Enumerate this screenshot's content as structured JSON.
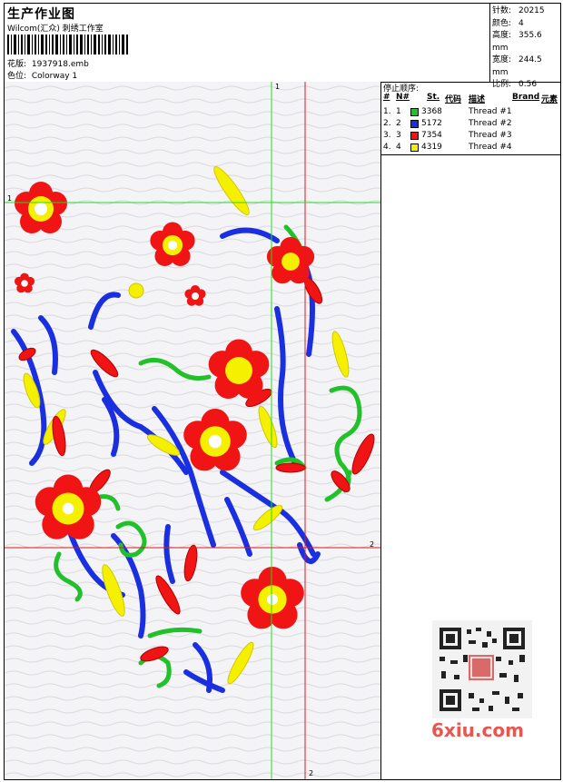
{
  "header": {
    "title": "生产作业图",
    "software": "Wilcom(汇众) 刺绣工作室",
    "pattern_label": "花版:",
    "pattern_value": "1937918.emb",
    "colorway_label": "色位:",
    "colorway_value": "Colorway 1"
  },
  "specs": [
    {
      "label": "针数:",
      "value": "20215"
    },
    {
      "label": "颜色:",
      "value": "4"
    },
    {
      "label": "高度:",
      "value": "355.6 mm"
    },
    {
      "label": "宽度:",
      "value": "244.5 mm"
    },
    {
      "label": "比例:",
      "value": "0.56"
    }
  ],
  "stop_sequence": {
    "title": "停止顺序:",
    "headers": {
      "num": "#",
      "n": "N#",
      "st": "St.",
      "code": "代码",
      "desc": "描述",
      "brand": "Brand",
      "element": "元素"
    },
    "rows": [
      {
        "num": "1.",
        "n": "1",
        "color": "#22c02a",
        "code": "3368",
        "desc": "Thread #1"
      },
      {
        "num": "2.",
        "n": "2",
        "color": "#1a2fe0",
        "code": "5172",
        "desc": "Thread #2"
      },
      {
        "num": "3.",
        "n": "3",
        "color": "#f01414",
        "code": "7354",
        "desc": "Thread #3"
      },
      {
        "num": "4.",
        "n": "4",
        "color": "#f5f000",
        "code": "4319",
        "desc": "Thread #4"
      }
    ]
  },
  "axis_labels": {
    "top": "1",
    "right": "2",
    "bottom": "2",
    "left": "1"
  },
  "watermark": "6xiu.com",
  "colors": {
    "green": "#22c02a",
    "blue": "#1a2fe0",
    "red": "#f01414",
    "yellow": "#f5f000",
    "guide_green": "#22dd22",
    "guide_red": "#e01818"
  }
}
